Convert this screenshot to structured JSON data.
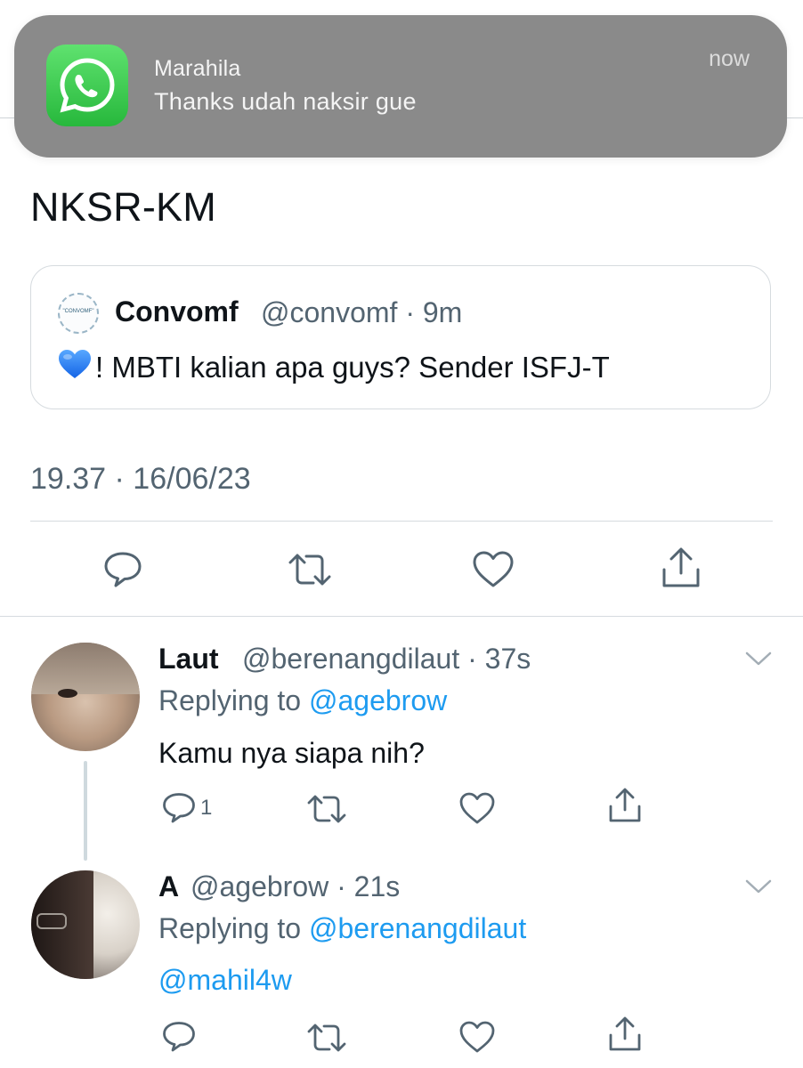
{
  "notification": {
    "app_icon": "whatsapp-icon",
    "sender": "Marahila",
    "message": "Thanks udah naksir gue",
    "time": "now"
  },
  "tweet": {
    "text": "NKSR-KM",
    "quoted": {
      "avatar_text": "\"CONVOMF\"",
      "name": "Convomf",
      "handle_time": "@convomf · 9m",
      "text": "! MBTI kalian apa guys? Sender ISFJ-T",
      "emoji": "💙"
    },
    "timestamp": "19.37 · 16/06/23",
    "actions": [
      "reply-icon",
      "retweet-icon",
      "like-icon",
      "share-icon"
    ]
  },
  "replies": [
    {
      "name": "Laut",
      "handle_time": "@berenangdilaut · 37s",
      "replying_prefix": "Replying to ",
      "replying_to": "@agebrow",
      "text": "Kamu nya siapa nih?",
      "reply_count": "1"
    },
    {
      "name": "A",
      "handle_time": "@agebrow · 21s",
      "replying_prefix": "Replying to ",
      "replying_to": "@berenangdilaut",
      "text": "@mahil4w"
    }
  ],
  "colors": {
    "link": "#1d9bf0",
    "secondary_text": "#536471",
    "notification_bg": "#8a8a8a",
    "whatsapp_green": "#2fc142"
  }
}
